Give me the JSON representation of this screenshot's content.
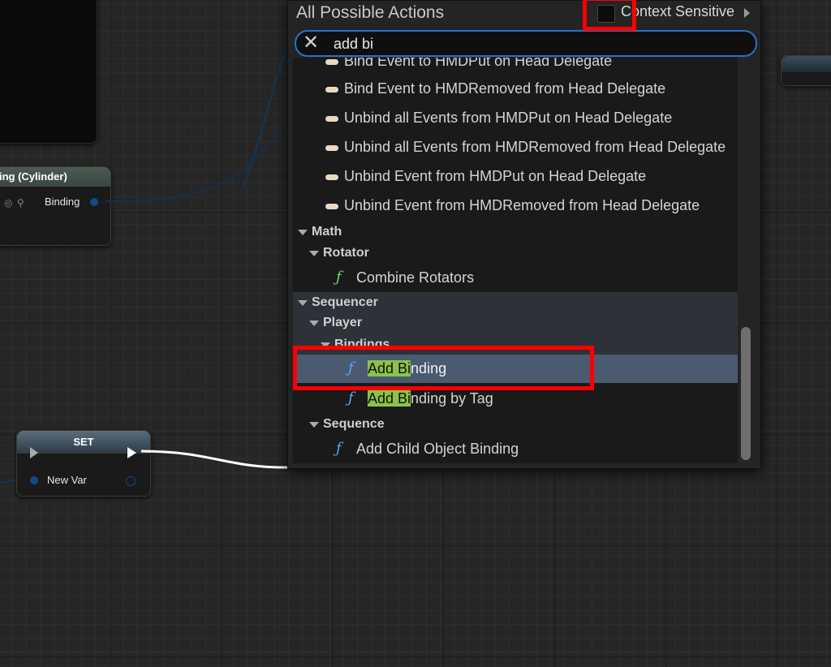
{
  "graph": {
    "binding_node": {
      "title": "ing (Cylinder)",
      "pin_label": "Binding"
    },
    "set_node": {
      "title": "SET",
      "var_label": "New Var"
    }
  },
  "popup": {
    "title": "All Possible Actions",
    "context_sensitive_label": "Context Sensitive",
    "search_value": "add bi",
    "clear_icon": "close-icon",
    "rows": {
      "r0": "Bind Event to HMDPut on Head Delegate",
      "r1": "Bind Event to HMDRemoved from Head Delegate",
      "r2": "Unbind all Events from HMDPut on Head Delegate",
      "r3": "Unbind all Events from HMDRemoved from Head Delegate",
      "r4": "Unbind Event from HMDPut on Head Delegate",
      "r5": "Unbind Event from HMDRemoved from Head Delegate",
      "cat_math": "Math",
      "cat_rotator": "Rotator",
      "combine_rotators": "Combine Rotators",
      "cat_sequencer": "Sequencer",
      "cat_player": "Player",
      "cat_bindings": "Bindings",
      "add_binding_hl": "Add Bi",
      "add_binding_rest": "nding",
      "add_binding_tag_hl": "Add Bi",
      "add_binding_tag_rest": "nding by Tag",
      "cat_sequence": "Sequence",
      "add_child": "Add Child Object Binding"
    }
  },
  "colors": {
    "highlight": "#8bc34a",
    "selection": "#4a5a70",
    "annotation": "#ff0000",
    "search_border": "#2672c9"
  }
}
